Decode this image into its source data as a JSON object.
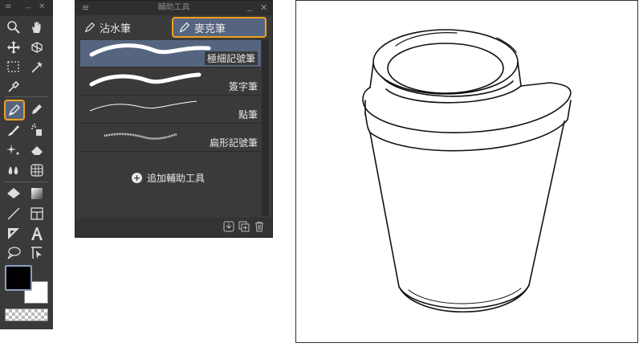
{
  "toolbox": {
    "menu_icon": "≡",
    "minimize_icon": "_",
    "close_icon": "✕"
  },
  "subpanel": {
    "title": "輔助工具",
    "minimize_icon": "_",
    "close_icon": "✕",
    "groups": [
      "沾水筆",
      "麥克筆"
    ],
    "active_group": "麥克筆",
    "items": [
      {
        "label": "極細記號筆"
      },
      {
        "label": "簽字筆"
      },
      {
        "label": "點筆"
      },
      {
        "label": "扁形記號筆"
      }
    ],
    "selected_item": "極細記號筆",
    "add_label": "追加輔助工具"
  },
  "colors": {
    "accent": "#f0a020",
    "selected_bg": "#56657f",
    "main_color": "#000000",
    "sub_color": "#ffffff"
  }
}
